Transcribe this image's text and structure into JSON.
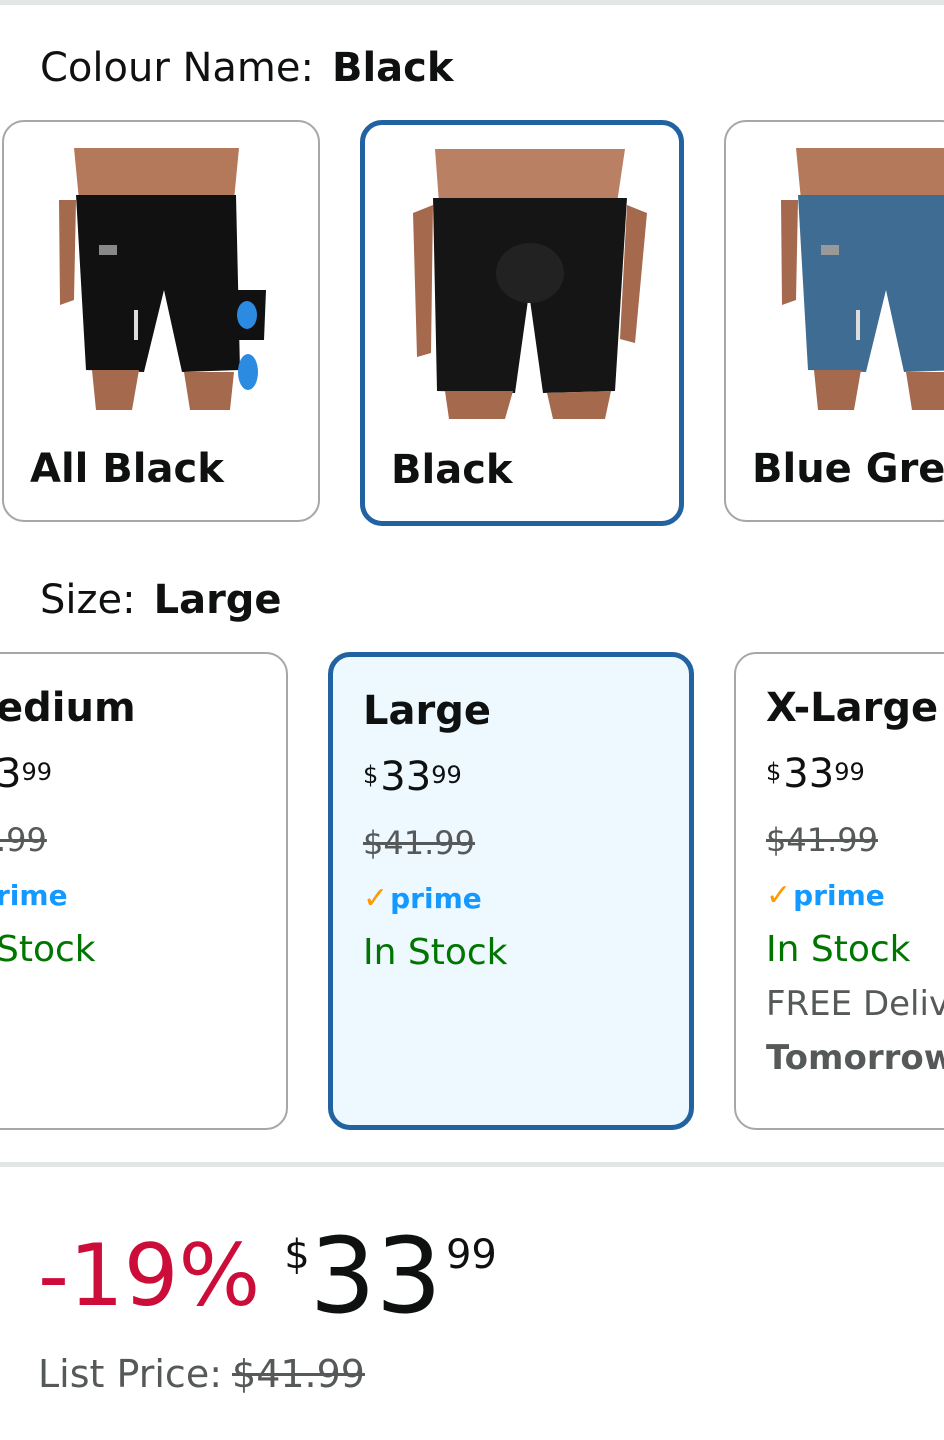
{
  "colour": {
    "label": "Colour Name:",
    "selected": "Black",
    "swatches": [
      {
        "name": "All Black",
        "color": "#111111"
      },
      {
        "name": "Black",
        "color": "#151515"
      },
      {
        "name": "Blue Grey",
        "color": "#3f6c92"
      }
    ]
  },
  "size": {
    "label": "Size:",
    "selected": "Large",
    "options": [
      {
        "name": "Medium",
        "name_visible": "edium",
        "price_whole": "3",
        "price_frac": "99",
        "old_visible": ".99",
        "prime": "rime",
        "stock": "Stock"
      },
      {
        "name": "Large",
        "currency": "$",
        "price_whole": "33",
        "price_frac": "99",
        "old": "$41.99",
        "prime": "prime",
        "stock": "In Stock"
      },
      {
        "name": "X-Large",
        "currency": "$",
        "price_whole": "33",
        "price_frac": "99",
        "old": "$41.99",
        "prime": "prime",
        "stock": "In Stock",
        "delivery": "FREE Deliv",
        "delivery_day": "Tomorrow"
      }
    ]
  },
  "summary": {
    "discount": "-19%",
    "currency": "$",
    "price_whole": "33",
    "price_frac": "99",
    "list_label": "List Price:",
    "list_price": "$41.99"
  },
  "colors": {
    "accent_border": "#2162a1",
    "selected_bg": "#edf8ff",
    "discount": "#cc0c39",
    "stock": "#007600",
    "prime": "#1399ff",
    "prime_check": "#ff9900"
  }
}
